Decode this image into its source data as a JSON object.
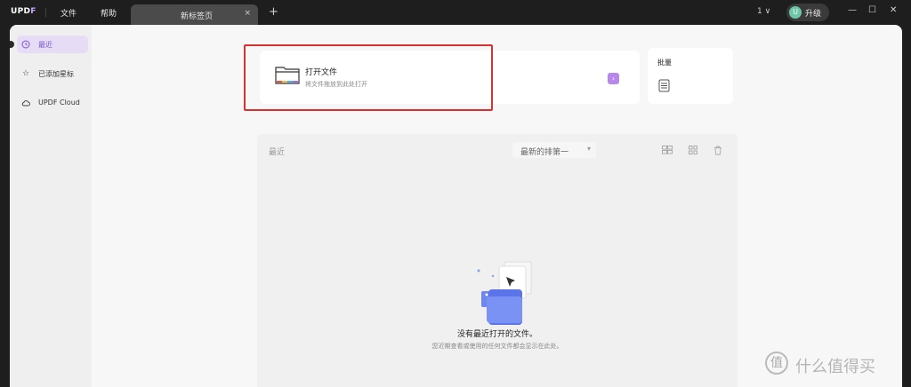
{
  "titlebar": {
    "logo_main": "UPD",
    "logo_f": "F",
    "menu": [
      "文件",
      "帮助"
    ],
    "tab_title": "新标签页",
    "tab_close": "×",
    "new_tab": "+",
    "page_indicator": "1 ∨",
    "avatar_letter": "U",
    "upgrade_label": "升级",
    "window_minimize": "—",
    "window_restore": "☐",
    "window_close": "✕"
  },
  "sidebar": {
    "items": [
      {
        "label": "最近",
        "icon": "clock-icon",
        "active": true
      },
      {
        "label": "已添加星标",
        "icon": "star-icon",
        "active": false
      },
      {
        "label": "UPDF Cloud",
        "icon": "cloud-icon",
        "active": false
      }
    ]
  },
  "open_card": {
    "title": "打开文件",
    "subtitle": "将文件拖放到此处打开",
    "arrow": "›"
  },
  "batch_card": {
    "title": "批量"
  },
  "recent": {
    "label": "最近",
    "sort_value": "最新的排第一",
    "empty_title": "没有最近打开的文件。",
    "empty_subtitle": "您近期查看或使用的任何文件都会显示在此处。"
  },
  "watermark": {
    "symbol": "值",
    "text": "什么值得买"
  },
  "colors": {
    "accent": "#b887ec",
    "highlight": "#d93030",
    "active_bg": "#e6dcf5"
  }
}
